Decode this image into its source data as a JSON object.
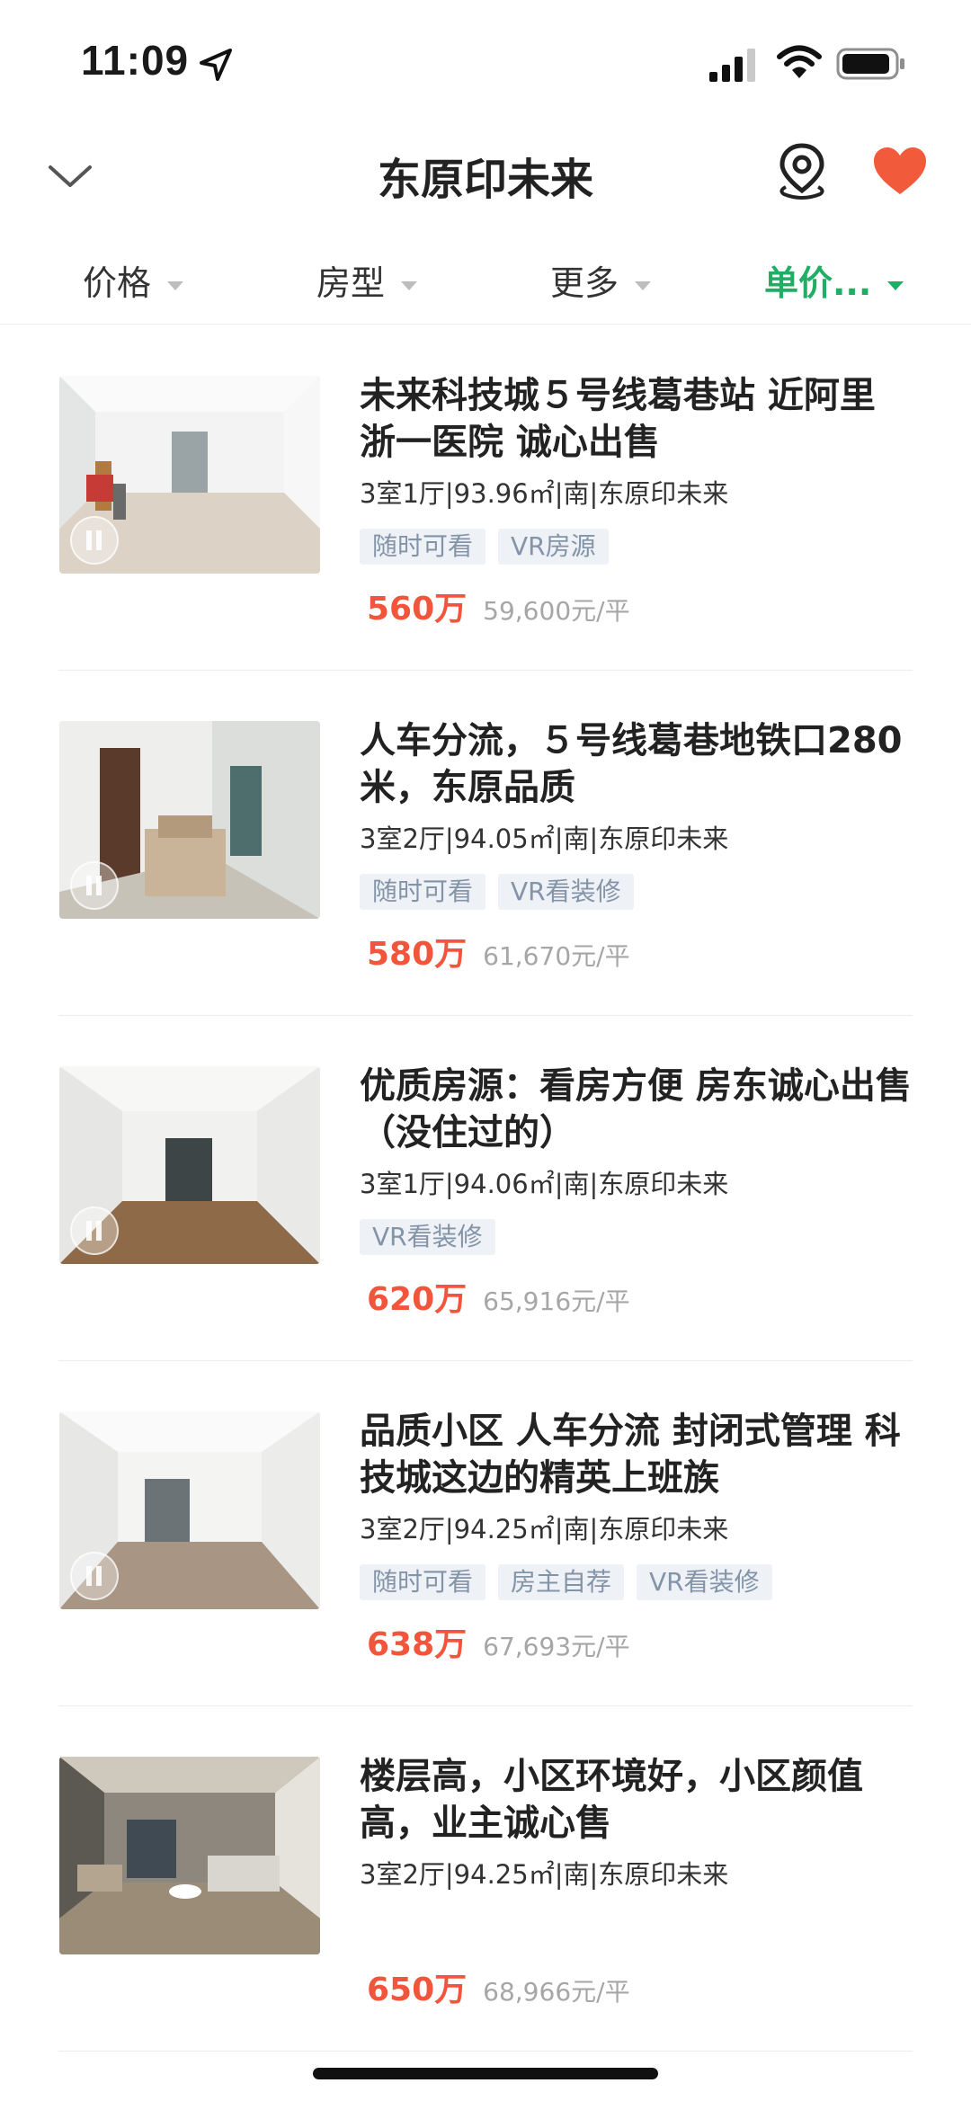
{
  "status_bar": {
    "time": "11:09"
  },
  "header": {
    "title": "东原印未来"
  },
  "filters": [
    {
      "label": "价格",
      "active": false
    },
    {
      "label": "房型",
      "active": false
    },
    {
      "label": "更多",
      "active": false
    },
    {
      "label": "单价...",
      "active": true
    }
  ],
  "listings": [
    {
      "title": "未来科技城５号线葛巷站 近阿里 浙一医院 诚心出售",
      "specs": "3室1厅|93.96㎡|南|东原印未来",
      "tags": [
        "随时可看",
        "VR房源"
      ],
      "price": "560万",
      "unit_price": "59,600元/平"
    },
    {
      "title": "人车分流，５号线葛巷地铁口280米，东原品质",
      "specs": "3室2厅|94.05㎡|南|东原印未来",
      "tags": [
        "随时可看",
        "VR看装修"
      ],
      "price": "580万",
      "unit_price": "61,670元/平"
    },
    {
      "title": "优质房源：看房方便 房东诚心出售（没住过的）",
      "specs": "3室1厅|94.06㎡|南|东原印未来",
      "tags": [
        "VR看装修"
      ],
      "price": "620万",
      "unit_price": "65,916元/平"
    },
    {
      "title": "品质小区 人车分流 封闭式管理 科技城这边的精英上班族",
      "specs": "3室2厅|94.25㎡|南|东原印未来",
      "tags": [
        "随时可看",
        "房主自荐",
        "VR看装修"
      ],
      "price": "638万",
      "unit_price": "67,693元/平"
    },
    {
      "title": "楼层高，小区环境好，小区颜值高，业主诚心售",
      "specs": "3室2厅|94.25㎡|南|东原印未来",
      "tags": [],
      "price": "650万",
      "unit_price": "68,966元/平"
    }
  ],
  "colors": {
    "accent_green": "#1fae63",
    "price_red": "#f1553b",
    "favorite_red": "#f25a3c",
    "tag_bg": "#eef1f5",
    "tag_text": "#8494a8"
  },
  "icons": {
    "back": "chevron-down-icon",
    "map": "map-pin-icon",
    "favorite": "heart-icon",
    "vr": "vr-play-icon"
  }
}
